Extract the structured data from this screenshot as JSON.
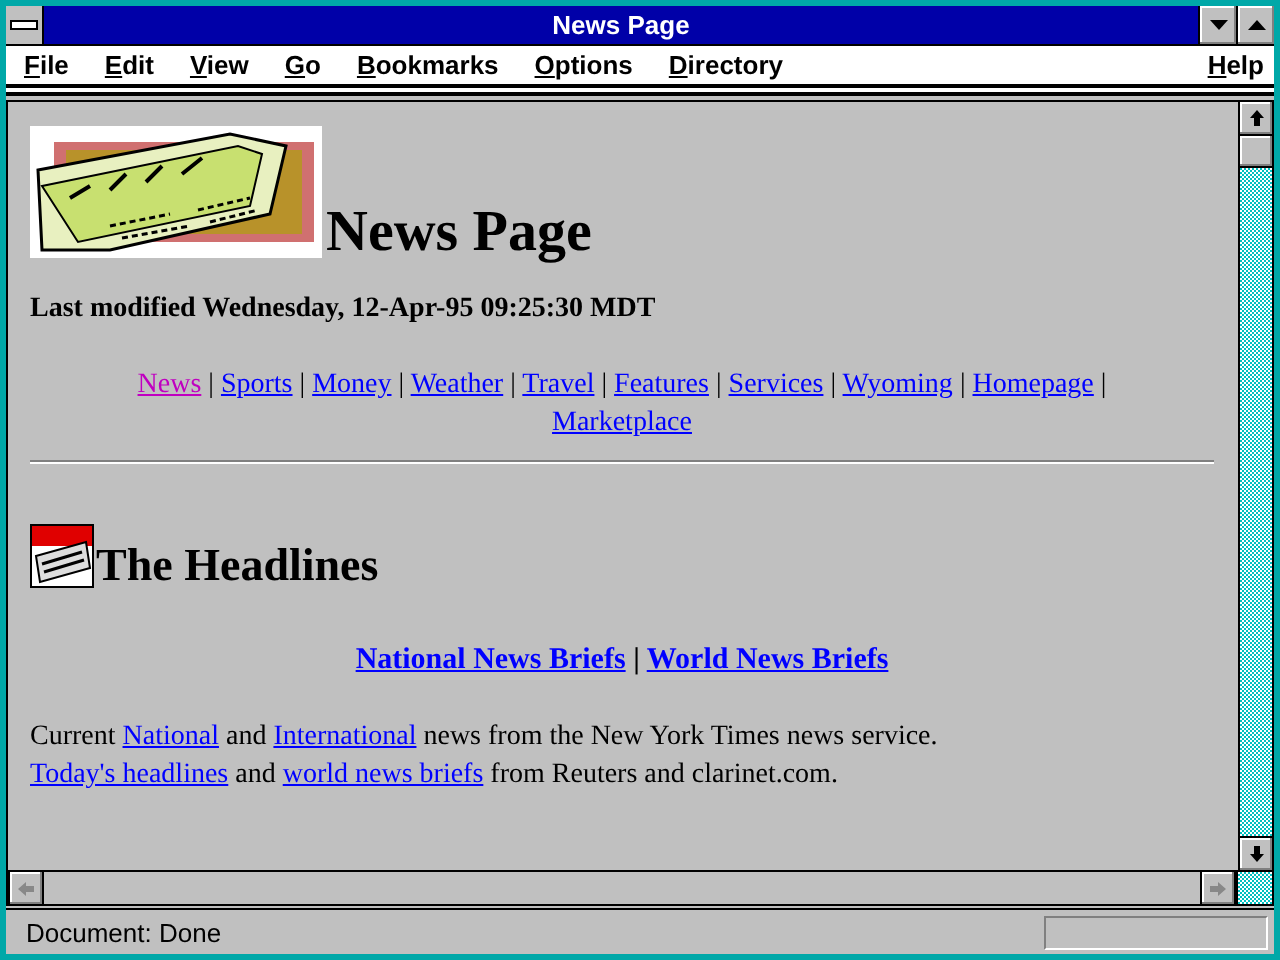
{
  "window": {
    "title": "News Page"
  },
  "menu": {
    "left": [
      {
        "label": "File"
      },
      {
        "label": "Edit"
      },
      {
        "label": "View"
      },
      {
        "label": "Go"
      },
      {
        "label": "Bookmarks"
      },
      {
        "label": "Options"
      },
      {
        "label": "Directory"
      }
    ],
    "right": [
      {
        "label": "Help"
      }
    ]
  },
  "page": {
    "heading": "News Page",
    "last_modified": "Last modified Wednesday, 12-Apr-95 09:25:30 MDT",
    "nav_links": [
      {
        "label": "News",
        "visited": true,
        "separator": "|"
      },
      {
        "label": "Sports",
        "visited": false,
        "separator": "|"
      },
      {
        "label": "Money",
        "visited": false,
        "separator": "|"
      },
      {
        "label": "Weather",
        "visited": false,
        "separator": "|"
      },
      {
        "label": "Travel",
        "visited": false,
        "separator": "|"
      },
      {
        "label": "Features",
        "visited": false,
        "separator": "|"
      },
      {
        "label": "Services",
        "visited": false,
        "separator": "|"
      },
      {
        "label": "Wyoming",
        "visited": false,
        "separator": "|"
      },
      {
        "label": "Homepage",
        "visited": false,
        "separator": "|"
      },
      {
        "label": "Marketplace",
        "visited": false
      }
    ],
    "section_heading": "The Headlines",
    "brief_links": [
      {
        "label": "National News Briefs",
        "separator": "|"
      },
      {
        "label": "World News Briefs"
      }
    ],
    "paragraph_lines": [
      [
        {
          "kind": "text",
          "text": "Current "
        },
        {
          "kind": "link",
          "text": "National"
        },
        {
          "kind": "text",
          "text": " and "
        },
        {
          "kind": "link",
          "text": "International"
        },
        {
          "kind": "text",
          "text": " news from the New York Times news service."
        }
      ],
      [
        {
          "kind": "link",
          "text": "Today's headlines"
        },
        {
          "kind": "text",
          "text": " and "
        },
        {
          "kind": "link",
          "text": "world news briefs"
        },
        {
          "kind": "text",
          "text": " from Reuters and clarinet.com."
        }
      ]
    ]
  },
  "status_bar": {
    "text": "Document: Done"
  }
}
